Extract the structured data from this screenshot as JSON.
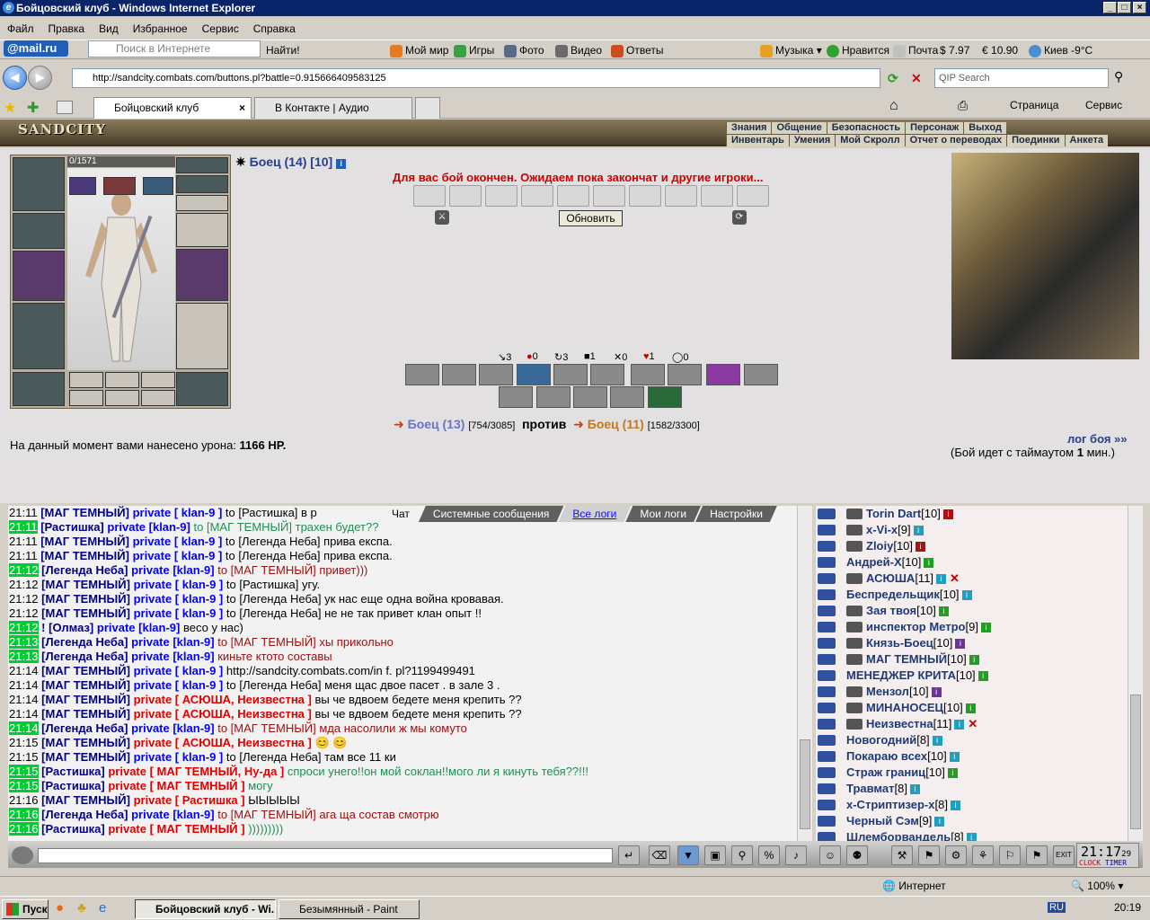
{
  "window": {
    "title": "Бойцовский клуб - Windows Internet Explorer"
  },
  "menu": [
    "Файл",
    "Правка",
    "Вид",
    "Избранное",
    "Сервис",
    "Справка"
  ],
  "mailbar": {
    "logo": "@mail.ru",
    "search_placeholder": "Поиск в Интернете",
    "find": "Найти!",
    "items": [
      "Мой мир",
      "Игры",
      "Фото",
      "Видео",
      "Ответы"
    ],
    "music": "Музыка",
    "like": "Нравится",
    "mail": "Почта",
    "usd": "7.97",
    "eur": "10.90",
    "weather": "Киев -9°C"
  },
  "address": {
    "url": "http://sandcity.combats.com/buttons.pl?battle=0.915666409583125",
    "qip_placeholder": "QIP Search"
  },
  "tabs": [
    {
      "label": "Бойцовский клуб"
    },
    {
      "label": "В Контакте | Аудио"
    }
  ],
  "toolbar_right": {
    "page": "Страница",
    "service": "Сервис"
  },
  "game_nav": {
    "logo": "SANDCITY",
    "row1": [
      "Знания",
      "Общение",
      "Безопасность",
      "Персонаж",
      "Выход"
    ],
    "row2": [
      "Инвентарь",
      "Умения",
      "Мой Скролл",
      "Отчет о переводах",
      "Поединки",
      "Анкета"
    ]
  },
  "character": {
    "hp": "0/1571",
    "title": "Боец (14) [10]"
  },
  "battle": {
    "message": "Для вас бой окончен. Ожидаем пока закончат и другие игроки...",
    "refresh": "Обновить",
    "stats": [
      "3",
      "0",
      "3",
      "1",
      "0",
      "1",
      "0"
    ],
    "fighter1": "Боец (13)",
    "fighter1_hp": "[754/3085]",
    "vs": "против",
    "fighter2": "Боец (11)",
    "fighter2_hp": "[1582/3300]",
    "damage_prefix": "На данный момент вами нанесено урона:",
    "damage_value": "1166 HP.",
    "log_link": "лог боя »»",
    "timeout_prefix": "(Бой идет с таймаутом",
    "timeout_value": "1",
    "timeout_suffix": "мин.)"
  },
  "chat_tabs": [
    "Чат",
    "Системные сообщения",
    "Все логи",
    "Мои логи",
    "Настройки"
  ],
  "chat": [
    {
      "t": "21:11",
      "hl": false,
      "nick": "[МАГ ТЕМНЫЙ]",
      "priv": "private [ klan-9 ]",
      "privRed": false,
      "to": "to [Растишка] в р",
      "msg": "",
      "mc": "msg-dark"
    },
    {
      "t": "21:11",
      "hl": true,
      "nick": "[Растишка]",
      "priv": "private [klan-9]",
      "privRed": false,
      "to": "to [МАГ ТЕМНЫЙ] трахен будет??",
      "msg": "",
      "mc": "msg-green"
    },
    {
      "t": "21:11",
      "hl": false,
      "nick": "[МАГ ТЕМНЫЙ]",
      "priv": "private [ klan-9 ]",
      "privRed": false,
      "to": "to [Легенда Неба] прива експа.",
      "msg": "",
      "mc": "msg-dark"
    },
    {
      "t": "21:11",
      "hl": false,
      "nick": "[МАГ ТЕМНЫЙ]",
      "priv": "private [ klan-9 ]",
      "privRed": false,
      "to": "to [Легенда Неба] прива експа.",
      "msg": "",
      "mc": "msg-dark"
    },
    {
      "t": "21:12",
      "hl": true,
      "nick": "[Легенда Неба]",
      "priv": "private [klan-9]",
      "privRed": false,
      "to": "to [МАГ ТЕМНЫЙ] привет)))",
      "msg": "",
      "mc": "msg-red"
    },
    {
      "t": "21:12",
      "hl": false,
      "nick": "[МАГ ТЕМНЫЙ]",
      "priv": "private [ klan-9 ]",
      "privRed": false,
      "to": "to [Растишка] угу.",
      "msg": "",
      "mc": "msg-dark"
    },
    {
      "t": "21:12",
      "hl": false,
      "nick": "[МАГ ТЕМНЫЙ]",
      "priv": "private [ klan-9 ]",
      "privRed": false,
      "to": "to [Легенда Неба] ук нас еще одна война кровавая.",
      "msg": "",
      "mc": "msg-dark"
    },
    {
      "t": "21:12",
      "hl": false,
      "nick": "[МАГ ТЕМНЫЙ]",
      "priv": "private [ klan-9 ]",
      "privRed": false,
      "to": "to [Легенда Неба] не не так привет клан опыт !!",
      "msg": "",
      "mc": "msg-dark"
    },
    {
      "t": "21:12",
      "hl": true,
      "nick": "! [Олмаз]",
      "priv": "private [klan-9]",
      "privRed": false,
      "to": "весо у нас)",
      "msg": "",
      "mc": "msg-dark"
    },
    {
      "t": "21:13",
      "hl": true,
      "nick": "[Легенда Неба]",
      "priv": "private [klan-9]",
      "privRed": false,
      "to": "to [МАГ ТЕМНЫЙ] хы прикольно",
      "msg": "",
      "mc": "msg-red"
    },
    {
      "t": "21:13",
      "hl": true,
      "nick": "[Легенда Неба]",
      "priv": "private [klan-9]",
      "privRed": false,
      "to": "киньте ктото составы",
      "msg": "",
      "mc": "msg-red"
    },
    {
      "t": "21:14",
      "hl": false,
      "nick": "[МАГ ТЕМНЫЙ]",
      "priv": "private [ klan-9 ]",
      "privRed": false,
      "to": "http://sandcity.combats.com/in f. pl?1199499491",
      "msg": "",
      "mc": "msg-dark"
    },
    {
      "t": "21:14",
      "hl": false,
      "nick": "[МАГ ТЕМНЫЙ]",
      "priv": "private [ klan-9 ]",
      "privRed": false,
      "to": "to [Легенда Неба] меня щас двое пасет . в зале 3 .",
      "msg": "",
      "mc": "msg-dark"
    },
    {
      "t": "21:14",
      "hl": false,
      "nick": "[МАГ ТЕМНЫЙ]",
      "priv": "private [ АСЮША, Неизвестна ]",
      "privRed": true,
      "to": "вы че вдвоем бедете меня крепить ??",
      "msg": "",
      "mc": "msg-dark"
    },
    {
      "t": "21:14",
      "hl": false,
      "nick": "[МАГ ТЕМНЫЙ]",
      "priv": "private [ АСЮША, Неизвестна ]",
      "privRed": true,
      "to": "вы че вдвоем бедете меня крепить ??",
      "msg": "",
      "mc": "msg-dark"
    },
    {
      "t": "21:14",
      "hl": true,
      "nick": "[Легенда Неба]",
      "priv": "private [klan-9]",
      "privRed": false,
      "to": "to [МАГ ТЕМНЫЙ] мда насолили ж мы комуто",
      "msg": "",
      "mc": "msg-red"
    },
    {
      "t": "21:15",
      "hl": false,
      "nick": "[МАГ ТЕМНЫЙ]",
      "priv": "private [ АСЮША, Неизвестна ]",
      "privRed": true,
      "to": "😊 😊",
      "msg": "",
      "mc": "msg-dark"
    },
    {
      "t": "21:15",
      "hl": false,
      "nick": "[МАГ ТЕМНЫЙ]",
      "priv": "private [ klan-9 ]",
      "privRed": false,
      "to": "to [Легенда Неба] там все 11 ки",
      "msg": "",
      "mc": "msg-dark"
    },
    {
      "t": "21:15",
      "hl": true,
      "nick": "[Растишка]",
      "priv": "private [ МАГ ТЕМНЫЙ, Ну-да ]",
      "privRed": true,
      "to": "спроси унего!!он мой соклан!!мого ли я кинуть тебя??!!!",
      "msg": "",
      "mc": "msg-green"
    },
    {
      "t": "21:15",
      "hl": true,
      "nick": "[Растишка]",
      "priv": "private [ МАГ ТЕМНЫЙ ]",
      "privRed": true,
      "to": "могу",
      "msg": "",
      "mc": "msg-green"
    },
    {
      "t": "21:16",
      "hl": false,
      "nick": "[МАГ ТЕМНЫЙ]",
      "priv": "private [ Растишка ]",
      "privRed": true,
      "to": "ЫЫЫЫЫ",
      "msg": "",
      "mc": "msg-dark"
    },
    {
      "t": "21:16",
      "hl": true,
      "nick": "[Легенда Неба]",
      "priv": "private [klan-9]",
      "privRed": false,
      "to": "to [МАГ ТЕМНЫЙ] ага ща состав смотрю",
      "msg": "",
      "mc": "msg-red"
    },
    {
      "t": "21:16",
      "hl": true,
      "nick": "[Растишка]",
      "priv": "private [ МАГ ТЕМНЫЙ ]",
      "privRed": true,
      "to": ")))))))))",
      "msg": "",
      "mc": "msg-green"
    }
  ],
  "players": [
    {
      "name": "Torin Dart",
      "lvl": "[10]",
      "inf": "r",
      "x": false,
      "avatar": true
    },
    {
      "name": "x-Vi-x",
      "lvl": "[9]",
      "inf": "b",
      "x": false,
      "avatar": true
    },
    {
      "name": "Zloiy",
      "lvl": "[10]",
      "inf": "r",
      "x": false,
      "avatar": true
    },
    {
      "name": "Андрей-Х",
      "lvl": "[10]",
      "inf": "",
      "x": false,
      "avatar": false
    },
    {
      "name": "АСЮША",
      "lvl": "[11]",
      "inf": "b",
      "x": true,
      "avatar": true
    },
    {
      "name": "Беспредельщик",
      "lvl": "[10]",
      "inf": "b",
      "x": false,
      "avatar": false
    },
    {
      "name": "Зая твоя",
      "lvl": "[10]",
      "inf": "",
      "x": false,
      "avatar": true
    },
    {
      "name": "инспектор Метро",
      "lvl": "[9]",
      "inf": "",
      "x": false,
      "avatar": true
    },
    {
      "name": "Князь-Боец",
      "lvl": "[10]",
      "inf": "p",
      "x": false,
      "avatar": true
    },
    {
      "name": "МАГ ТЕМНЫЙ",
      "lvl": "[10]",
      "inf": "",
      "x": false,
      "avatar": true
    },
    {
      "name": "МЕНЕДЖЕР КРИТА",
      "lvl": "[10]",
      "inf": "",
      "x": false,
      "avatar": false
    },
    {
      "name": "Мензол",
      "lvl": "[10]",
      "inf": "p",
      "x": false,
      "avatar": true
    },
    {
      "name": "МИНАНОСЕЦ",
      "lvl": "[10]",
      "inf": "",
      "x": false,
      "avatar": true
    },
    {
      "name": "Неизвестна",
      "lvl": "[11]",
      "inf": "b",
      "x": true,
      "avatar": true
    },
    {
      "name": "Новогодний",
      "lvl": "[8]",
      "inf": "b",
      "x": false,
      "avatar": false
    },
    {
      "name": "Покараю всех",
      "lvl": "[10]",
      "inf": "b",
      "x": false,
      "avatar": false
    },
    {
      "name": "Страж границ",
      "lvl": "[10]",
      "inf": "",
      "x": false,
      "avatar": false
    },
    {
      "name": "Травмат",
      "lvl": "[8]",
      "inf": "b",
      "x": false,
      "avatar": false
    },
    {
      "name": "х-Стриптизер-х",
      "lvl": "[8]",
      "inf": "b",
      "x": false,
      "avatar": false
    },
    {
      "name": "Черный Сэм",
      "lvl": "[9]",
      "inf": "b",
      "x": false,
      "avatar": false
    },
    {
      "name": "Шлемборвандель",
      "lvl": "[8]",
      "inf": "b",
      "x": false,
      "avatar": false
    }
  ],
  "clock": {
    "time": "21:17",
    "sec": "29",
    "clock_label": "CLOCK",
    "timer_label": "TIMER"
  },
  "statusbar": {
    "zone": "Интернет",
    "zoom": "100%"
  },
  "taskbar": {
    "start": "Пуск",
    "items": [
      "Бойцовский клуб - Wi...",
      "Безымянный - Paint"
    ],
    "lang": "RU",
    "time": "20:19"
  },
  "colors": {
    "chat_highlight": "#00cc33",
    "title_bar": "#0a246a",
    "battle_msg": "#d00000"
  }
}
